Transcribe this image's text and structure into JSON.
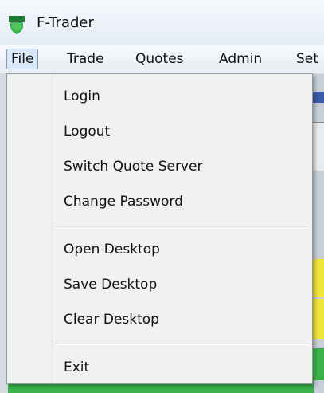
{
  "window": {
    "title": "F-Trader"
  },
  "menubar": {
    "items": [
      {
        "label": "File"
      },
      {
        "label": "Trade"
      },
      {
        "label": "Quotes"
      },
      {
        "label": "Admin"
      },
      {
        "label": "Set"
      }
    ]
  },
  "file_menu": {
    "items": [
      {
        "label": "Login"
      },
      {
        "label": "Logout"
      },
      {
        "label": "Switch Quote Server"
      },
      {
        "label": "Change Password"
      },
      {
        "label": "Open Desktop"
      },
      {
        "label": "Save Desktop"
      },
      {
        "label": "Clear Desktop"
      },
      {
        "label": "Exit"
      }
    ]
  },
  "icons": {
    "app": "app-logo-icon"
  },
  "colors": {
    "accent_green": "#3bb34a",
    "highlight_yellow": "#f0e63c",
    "menu_active_border": "#7d9cc2"
  }
}
